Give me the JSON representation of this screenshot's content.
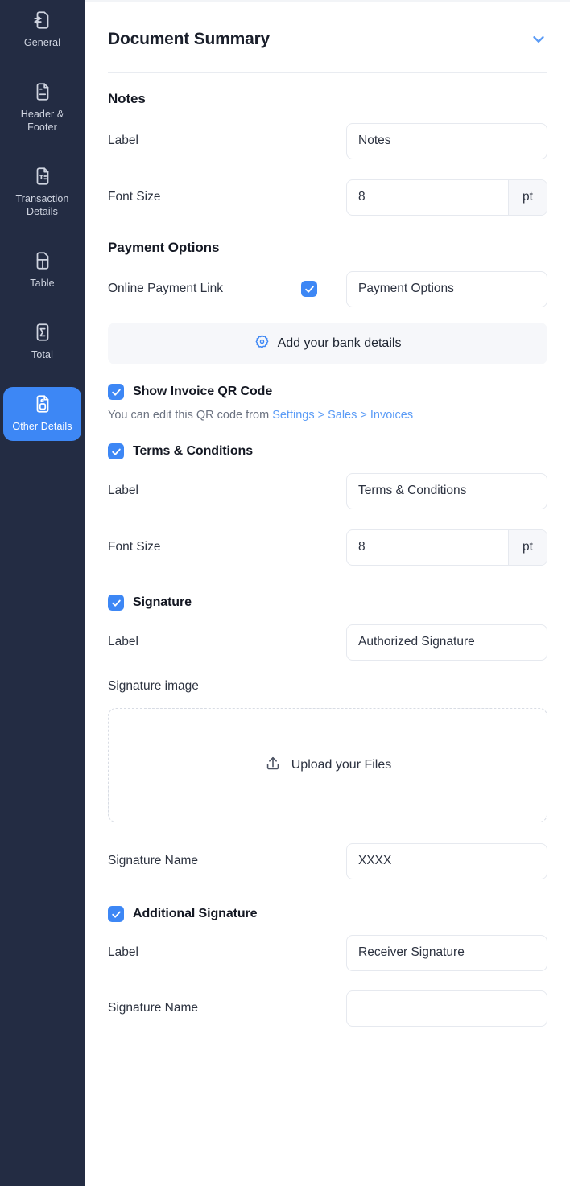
{
  "sidebar": {
    "items": [
      {
        "label": "General",
        "icon": "document-sliders-icon",
        "active": false
      },
      {
        "label": "Header & Footer",
        "icon": "document-lines-icon",
        "active": false
      },
      {
        "label": "Transaction Details",
        "icon": "document-text-icon",
        "active": false
      },
      {
        "label": "Table",
        "icon": "document-table-icon",
        "active": false
      },
      {
        "label": "Total",
        "icon": "document-sigma-icon",
        "active": false
      },
      {
        "label": "Other Details",
        "icon": "document-circle-icon",
        "active": true
      }
    ],
    "active_color": "#3d87f5",
    "background_color": "#232c43"
  },
  "panel": {
    "title": "Document Summary",
    "collapse_icon": "chevron-down-icon",
    "accent_color": "#3d87f5"
  },
  "notes": {
    "section_title": "Notes",
    "label_row_label": "Label",
    "label_value": "Notes",
    "font_size_row_label": "Font Size",
    "font_size_value": "8",
    "font_size_unit": "pt"
  },
  "payment": {
    "section_title": "Payment Options",
    "online_payment_label": "Online Payment Link",
    "online_payment_checked": true,
    "online_payment_value": "Payment Options",
    "bank_button_label": "Add your bank details",
    "bank_button_icon": "gear-icon"
  },
  "qr": {
    "title": "Show Invoice QR Code",
    "checked": true,
    "hint_prefix": "You can edit this QR code from ",
    "hint_link": "Settings > Sales > Invoices"
  },
  "terms": {
    "title": "Terms & Conditions",
    "checked": true,
    "label_row_label": "Label",
    "label_value": "Terms & Conditions",
    "font_size_row_label": "Font Size",
    "font_size_value": "8",
    "font_size_unit": "pt"
  },
  "signature": {
    "title": "Signature",
    "checked": true,
    "label_row_label": "Label",
    "label_value": "Authorized Signature",
    "image_label": "Signature image",
    "upload_label": "Upload your Files",
    "upload_icon": "upload-icon",
    "name_row_label": "Signature Name",
    "name_value": "XXXX"
  },
  "additional_signature": {
    "title": "Additional Signature",
    "checked": true,
    "label_row_label": "Label",
    "label_value": "Receiver Signature",
    "name_row_label": "Signature Name",
    "name_value": ""
  }
}
